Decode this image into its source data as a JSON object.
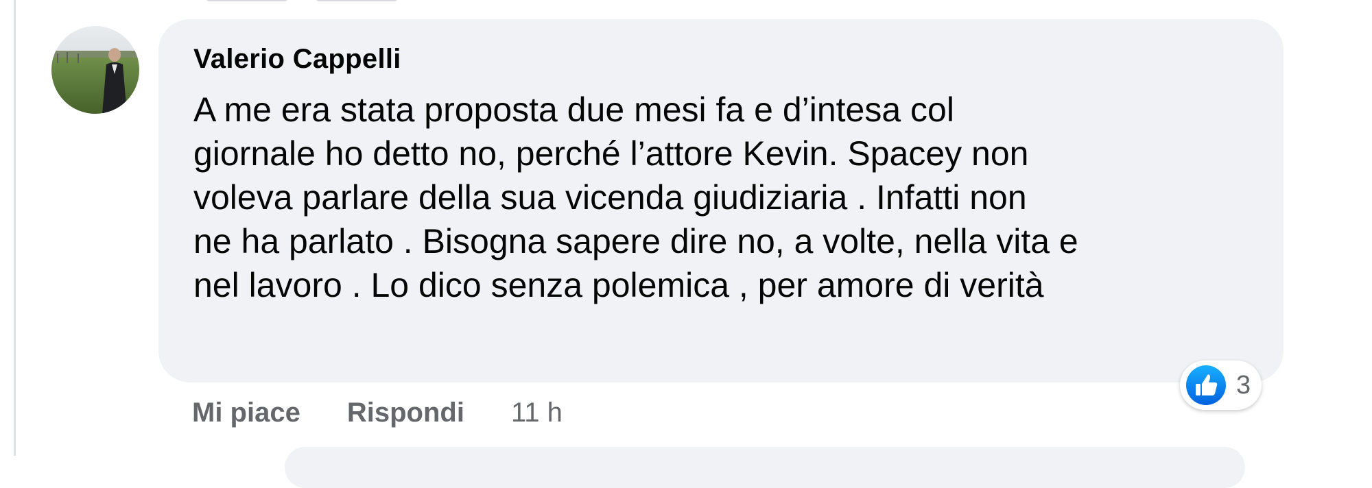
{
  "comment": {
    "author": "Valerio Cappelli",
    "text_lines": [
      "A me era stata proposta due mesi fa e d’intesa col",
      "giornale ho detto no, perché l’attore Kevin. Spacey non",
      "voleva parlare della sua vicenda giudiziaria . Infatti non",
      "ne ha parlato . Bisogna sapere dire no, a volte, nella vita e",
      "nel lavoro . Lo dico senza polemica , per amore di verità"
    ],
    "reactions": {
      "icon": "thumbs-up-icon",
      "count": "3",
      "color": "#1877f2"
    },
    "actions": {
      "like_label": "Mi piace",
      "reply_label": "Rispondi",
      "time": "11 h"
    }
  },
  "colors": {
    "bubble": "#f0f2f5",
    "text": "#050505",
    "secondary": "#65676b",
    "accent": "#1877f2"
  }
}
